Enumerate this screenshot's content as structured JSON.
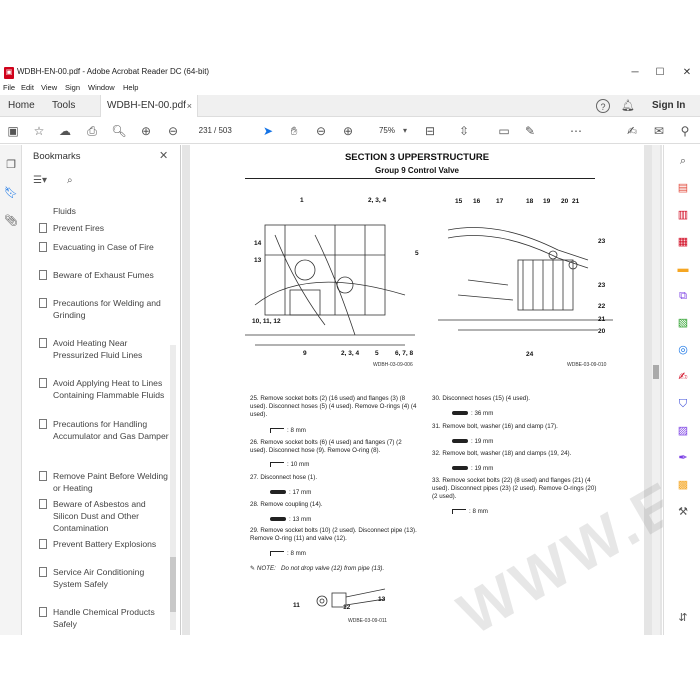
{
  "window": {
    "title": "WDBH-EN-00.pdf - Adobe Acrobat Reader DC (64-bit)",
    "minimize": "─",
    "maximize": "☐",
    "close": "✕"
  },
  "menu": [
    "File",
    "Edit",
    "View",
    "Sign",
    "Window",
    "Help"
  ],
  "tabs": {
    "home": "Home",
    "tools": "Tools",
    "doc": "WDBH-EN-00.pdf",
    "doc_close": "×",
    "signin": "Sign In"
  },
  "toolbar": {
    "page_current": "231",
    "page_total": "/ 503",
    "zoom": "75%"
  },
  "bookmarks": {
    "header": "Bookmarks",
    "items": [
      "Fluids",
      "Prevent Fires",
      "Evacuating in Case of Fire",
      "Beware of Exhaust Fumes",
      "Precautions for Welding and Grinding",
      "Avoid Heating Near Pressurized Fluid Lines",
      "Avoid Applying Heat to Lines Containing Flammable Fluids",
      "Precautions for Handling Accumulator and Gas Damper",
      "Remove Paint Before Welding or Heating",
      "Beware of Asbestos and Silicon Dust and Other Contamination",
      "Prevent Battery Explosions",
      "Service Air Conditioning System Safely",
      "Handle Chemical Products Safely"
    ]
  },
  "document": {
    "section": "SECTION 3 UPPERSTRUCTURE",
    "group": "Group 9 Control Valve",
    "fig1_code": "WDBH-03-09-006",
    "fig2_code": "WDBE-03-09-010",
    "fig3_code": "WDBE-03-09-011",
    "watermark": "WWW.EPCATALOG.COM",
    "callouts_fig1": [
      "1",
      "2, 3, 4",
      "14",
      "13",
      "5",
      "10, 11, 12",
      "9",
      "2, 3, 4",
      "5",
      "6, 7, 8"
    ],
    "callouts_fig2": [
      "15",
      "16",
      "17",
      "18",
      "19",
      "20",
      "21",
      "23",
      "22",
      "21",
      "20",
      "24",
      "23"
    ],
    "callouts_fig3": [
      "11",
      "12",
      "13"
    ],
    "steps_left": [
      {
        "text": "25.  Remove socket bolts (2) (16 used) and flanges (3) (8 used). Disconnect hoses (5) (4 used). Remove O-rings (4) (4 used).",
        "tool": ": 8 mm",
        "tooltype": "hex"
      },
      {
        "text": "26.  Remove socket bolts (6) (4 used) and flanges (7) (2 used). Disconnect hose (9). Remove O-ring (8).",
        "tool": ": 10 mm",
        "tooltype": "hex"
      },
      {
        "text": "27.  Disconnect hose (1).",
        "tool": ": 17 mm",
        "tooltype": "wrench"
      },
      {
        "text": "28.  Remove coupling (14).",
        "tool": ": 13 mm",
        "tooltype": "wrench"
      },
      {
        "text": "29.  Remove socket bolts (10) (2 used). Disconnect pipe (13). Remove O-ring (11) and valve (12).",
        "tool": ": 8 mm",
        "tooltype": "hex"
      }
    ],
    "note_label": "NOTE:",
    "note_text": "Do not drop valve (12) from pipe (13).",
    "steps_right": [
      {
        "text": "30.  Disconnect hoses (15) (4 used).",
        "tool": ": 36 mm",
        "tooltype": "wrench"
      },
      {
        "text": "31.  Remove bolt, washer (16) and clamp (17).",
        "tool": ": 19 mm",
        "tooltype": "wrench"
      },
      {
        "text": "32.  Remove bolt, washer (18) and clamps (19, 24).",
        "tool": ": 19 mm",
        "tooltype": "wrench"
      },
      {
        "text": "33.  Remove socket bolts (22) (8 used) and flanges (21) (4 used). Disconnect pipes (23) (2 used). Remove O-rings (20) (2 used).",
        "tool": ": 8 mm",
        "tooltype": "hex"
      }
    ]
  },
  "colors": {
    "accent": "#1473e6",
    "pdf_red": "#d0021b"
  }
}
